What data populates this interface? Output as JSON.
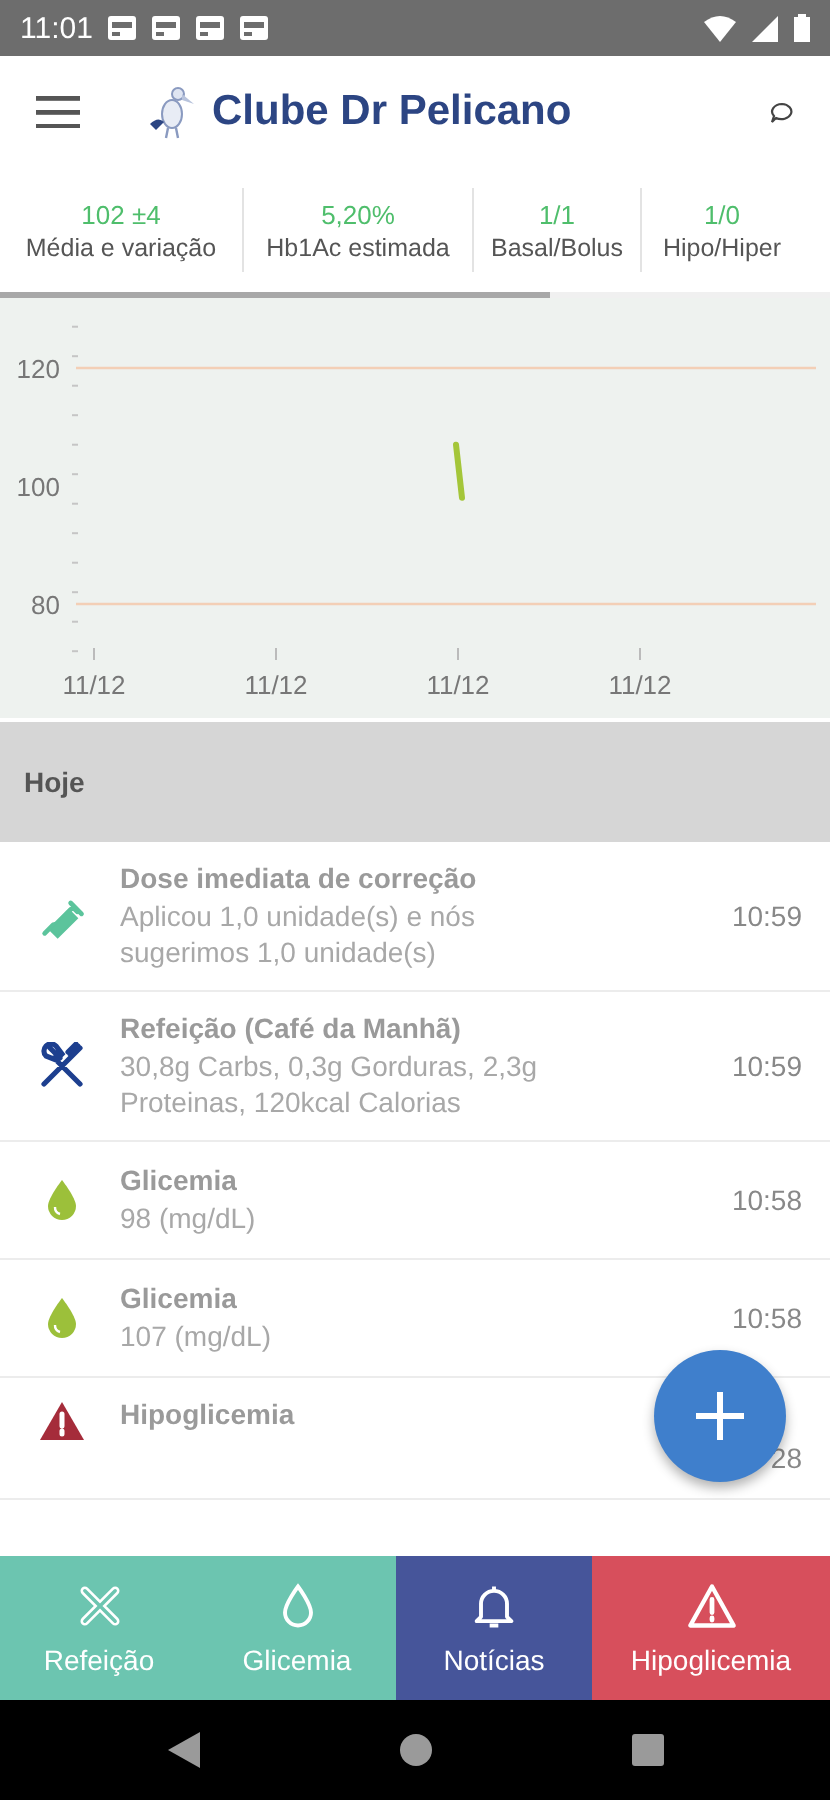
{
  "status_bar": {
    "time": "11:01"
  },
  "app_bar": {
    "title": "Clube Dr Pelicano"
  },
  "stats": [
    {
      "value": "102 ±4",
      "label": "Média e variação"
    },
    {
      "value": "5,20%",
      "label": "Hb1Ac estimada"
    },
    {
      "value": "1/1",
      "label": "Basal/Bolus"
    },
    {
      "value": "1/0",
      "label": "Hipo/Hiper"
    }
  ],
  "chart": {
    "y_labels": [
      "120",
      "100",
      "80"
    ],
    "x_labels": [
      "11/12",
      "11/12",
      "11/12",
      "11/12"
    ]
  },
  "section": {
    "title": "Hoje"
  },
  "entries": [
    {
      "kind": "injection",
      "title": "Dose imediata de correção",
      "detail": "Aplicou 1,0 unidade(s) e nós sugerimos 1,0 unidade(s)",
      "time": "10:59"
    },
    {
      "kind": "meal",
      "title": "Refeição (Café da Manhã)",
      "detail": "30,8g Carbs, 0,3g Gorduras, 2,3g Proteinas, 120kcal Calorias",
      "time": "10:59"
    },
    {
      "kind": "glucose",
      "title": "Glicemia",
      "detail": "98 (mg/dL)",
      "time": "10:58"
    },
    {
      "kind": "glucose",
      "title": "Glicemia",
      "detail": "107 (mg/dL)",
      "time": "10:58"
    },
    {
      "kind": "alert",
      "title": "Hipoglicemia",
      "time": "28"
    }
  ],
  "bottom_nav": [
    {
      "kind": "meal",
      "label": "Refeição",
      "color": "#6cc5b0"
    },
    {
      "kind": "glucose",
      "label": "Glicemia",
      "color": "#6cc5b0"
    },
    {
      "kind": "bell",
      "label": "Notícias",
      "color": "#46559a"
    },
    {
      "kind": "alert",
      "label": "Hipoglicemia",
      "color": "#d74f5c"
    }
  ]
}
